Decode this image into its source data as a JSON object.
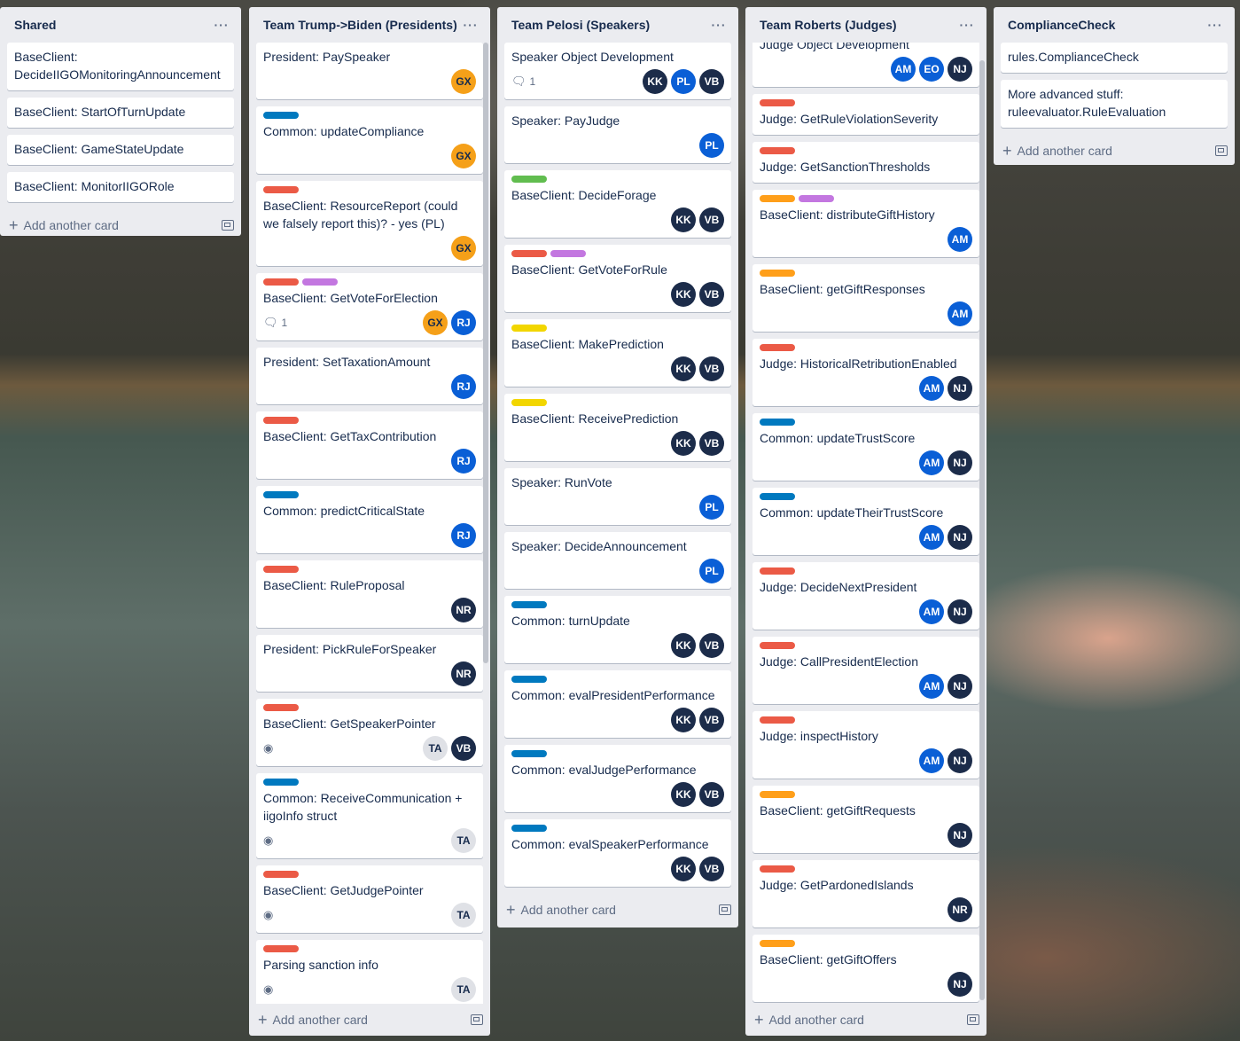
{
  "add_card_label": "Add another card",
  "lists": [
    {
      "title": "Shared",
      "cards": [
        {
          "title": "BaseClient: DecideIIGOMonitoringAnnouncement",
          "labels": [],
          "members": [],
          "comments": null,
          "watch": false
        },
        {
          "title": "BaseClient: StartOfTurnUpdate",
          "labels": [],
          "members": [],
          "comments": null,
          "watch": false
        },
        {
          "title": "BaseClient: GameStateUpdate",
          "labels": [],
          "members": [],
          "comments": null,
          "watch": false
        },
        {
          "title": "BaseClient: MonitorIIGORole",
          "labels": [],
          "members": [],
          "comments": null,
          "watch": false
        }
      ]
    },
    {
      "title": "Team Trump->Biden (Presidents)",
      "cards": [
        {
          "title": "President: PaySpeaker",
          "labels": [],
          "members": [
            "GX"
          ],
          "comments": null,
          "watch": false
        },
        {
          "title": "Common: updateCompliance",
          "labels": [
            "blue"
          ],
          "members": [
            "GX"
          ],
          "comments": null,
          "watch": false
        },
        {
          "title": "BaseClient: ResourceReport (could we falsely report this)? - yes (PL)",
          "labels": [
            "red"
          ],
          "members": [
            "GX"
          ],
          "comments": null,
          "watch": false
        },
        {
          "title": "BaseClient: GetVoteForElection",
          "labels": [
            "red",
            "purple"
          ],
          "members": [
            "GX",
            "RJ"
          ],
          "comments": "1",
          "watch": false
        },
        {
          "title": "President: SetTaxationAmount",
          "labels": [],
          "members": [
            "RJ"
          ],
          "comments": null,
          "watch": false
        },
        {
          "title": "BaseClient: GetTaxContribution",
          "labels": [
            "red"
          ],
          "members": [
            "RJ"
          ],
          "comments": null,
          "watch": false
        },
        {
          "title": "Common: predictCriticalState",
          "labels": [
            "blue"
          ],
          "members": [
            "RJ"
          ],
          "comments": null,
          "watch": false
        },
        {
          "title": "BaseClient: RuleProposal",
          "labels": [
            "red"
          ],
          "members": [
            "NR"
          ],
          "comments": null,
          "watch": false
        },
        {
          "title": "President: PickRuleForSpeaker",
          "labels": [],
          "members": [
            "NR"
          ],
          "comments": null,
          "watch": false
        },
        {
          "title": "BaseClient: GetSpeakerPointer",
          "labels": [
            "red"
          ],
          "members": [
            "TA",
            "VB"
          ],
          "comments": null,
          "watch": true
        },
        {
          "title": "Common: ReceiveCommunication + iigoInfo struct",
          "labels": [
            "blue"
          ],
          "members": [
            "TA"
          ],
          "comments": null,
          "watch": true
        },
        {
          "title": "BaseClient: GetJudgePointer",
          "labels": [
            "red"
          ],
          "members": [
            "TA"
          ],
          "comments": null,
          "watch": true
        },
        {
          "title": "Parsing sanction info",
          "labels": [
            "red"
          ],
          "members": [
            "TA"
          ],
          "comments": null,
          "watch": true
        }
      ]
    },
    {
      "title": "Team Pelosi (Speakers)",
      "cards": [
        {
          "title": "Speaker Object Development",
          "labels": [],
          "members": [
            "KK",
            "PL",
            "VB"
          ],
          "comments": "1",
          "watch": false
        },
        {
          "title": "Speaker: PayJudge",
          "labels": [],
          "members": [
            "PL"
          ],
          "comments": null,
          "watch": false
        },
        {
          "title": "BaseClient: DecideForage",
          "labels": [
            "green"
          ],
          "members": [
            "KK",
            "VB"
          ],
          "comments": null,
          "watch": false
        },
        {
          "title": "BaseClient: GetVoteForRule",
          "labels": [
            "red",
            "purple"
          ],
          "members": [
            "KK",
            "VB"
          ],
          "comments": null,
          "watch": false
        },
        {
          "title": "BaseClient: MakePrediction",
          "labels": [
            "yellow"
          ],
          "members": [
            "KK",
            "VB"
          ],
          "comments": null,
          "watch": false
        },
        {
          "title": "BaseClient: ReceivePrediction",
          "labels": [
            "yellow"
          ],
          "members": [
            "KK",
            "VB"
          ],
          "comments": null,
          "watch": false
        },
        {
          "title": "Speaker: RunVote",
          "labels": [],
          "members": [
            "PL"
          ],
          "comments": null,
          "watch": false
        },
        {
          "title": "Speaker: DecideAnnouncement",
          "labels": [],
          "members": [
            "PL"
          ],
          "comments": null,
          "watch": false
        },
        {
          "title": "Common: turnUpdate",
          "labels": [
            "blue"
          ],
          "members": [
            "KK",
            "VB"
          ],
          "comments": null,
          "watch": false
        },
        {
          "title": "Common: evalPresidentPerformance",
          "labels": [
            "blue"
          ],
          "members": [
            "KK",
            "VB"
          ],
          "comments": null,
          "watch": false
        },
        {
          "title": "Common: evalJudgePerformance",
          "labels": [
            "blue"
          ],
          "members": [
            "KK",
            "VB"
          ],
          "comments": null,
          "watch": false
        },
        {
          "title": "Common: evalSpeakerPerformance",
          "labels": [
            "blue"
          ],
          "members": [
            "KK",
            "VB"
          ],
          "comments": null,
          "watch": false
        }
      ]
    },
    {
      "title": "Team Roberts (Judges)",
      "cards": [
        {
          "title": "Judge Object Development",
          "labels": [],
          "members": [
            "AM",
            "EO",
            "NJ"
          ],
          "comments": null,
          "watch": false
        },
        {
          "title": "Judge: GetRuleViolationSeverity",
          "labels": [
            "red"
          ],
          "members": [],
          "comments": null,
          "watch": false
        },
        {
          "title": "Judge: GetSanctionThresholds",
          "labels": [
            "red"
          ],
          "members": [],
          "comments": null,
          "watch": false
        },
        {
          "title": "BaseClient: distributeGiftHistory",
          "labels": [
            "orange",
            "purple"
          ],
          "members": [
            "AM"
          ],
          "comments": null,
          "watch": false
        },
        {
          "title": "BaseClient: getGiftResponses",
          "labels": [
            "orange"
          ],
          "members": [
            "AM"
          ],
          "comments": null,
          "watch": false
        },
        {
          "title": "Judge: HistoricalRetributionEnabled",
          "labels": [
            "red"
          ],
          "members": [
            "AM",
            "NJ"
          ],
          "comments": null,
          "watch": false
        },
        {
          "title": "Common: updateTrustScore",
          "labels": [
            "blue"
          ],
          "members": [
            "AM",
            "NJ"
          ],
          "comments": null,
          "watch": false
        },
        {
          "title": "Common: updateTheirTrustScore",
          "labels": [
            "blue"
          ],
          "members": [
            "AM",
            "NJ"
          ],
          "comments": null,
          "watch": false
        },
        {
          "title": "Judge: DecideNextPresident",
          "labels": [
            "red"
          ],
          "members": [
            "AM",
            "NJ"
          ],
          "comments": null,
          "watch": false
        },
        {
          "title": "Judge: CallPresidentElection",
          "labels": [
            "red"
          ],
          "members": [
            "AM",
            "NJ"
          ],
          "comments": null,
          "watch": false
        },
        {
          "title": "Judge: inspectHistory",
          "labels": [
            "red"
          ],
          "members": [
            "AM",
            "NJ"
          ],
          "comments": null,
          "watch": false
        },
        {
          "title": "BaseClient: getGiftRequests",
          "labels": [
            "orange"
          ],
          "members": [
            "NJ"
          ],
          "comments": null,
          "watch": false
        },
        {
          "title": "Judge: GetPardonedIslands",
          "labels": [
            "red"
          ],
          "members": [
            "NR"
          ],
          "comments": null,
          "watch": false
        },
        {
          "title": "BaseClient: getGiftOffers",
          "labels": [
            "orange"
          ],
          "members": [
            "NJ"
          ],
          "comments": null,
          "watch": false
        }
      ]
    },
    {
      "title": "ComplianceCheck",
      "cards": [
        {
          "title": "rules.ComplianceCheck",
          "labels": [],
          "members": [],
          "comments": null,
          "watch": false
        },
        {
          "title": "More advanced stuff: ruleevaluator.RuleEvaluation",
          "labels": [],
          "members": [],
          "comments": null,
          "watch": false
        }
      ]
    }
  ],
  "avatar_colors": {
    "GX": "#f5a019",
    "RJ": "#0a5fd6",
    "NR": "#1c2c4a",
    "TA": "#dfe1e6",
    "VB": "#1c2c4a",
    "KK": "#1c2c4a",
    "PL": "#0a5fd6",
    "AM": "#0a5fd6",
    "EO": "#0a5fd6",
    "NJ": "#1c2c4a"
  }
}
